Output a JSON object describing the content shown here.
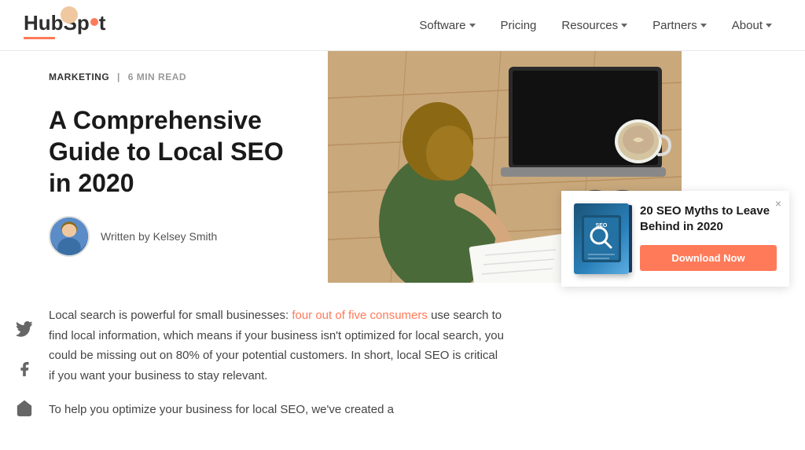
{
  "header": {
    "logo_text_hub": "Hub",
    "logo_text_spot": "Sp",
    "logo_text_spot2": "t",
    "nav_items": [
      {
        "label": "Software",
        "has_dropdown": true
      },
      {
        "label": "Pricing",
        "has_dropdown": false
      },
      {
        "label": "Resources",
        "has_dropdown": true
      },
      {
        "label": "Partners",
        "has_dropdown": true
      },
      {
        "label": "About",
        "has_dropdown": true
      }
    ]
  },
  "article": {
    "category": "MARKETING",
    "read_time": "6 MIN READ",
    "title": "A Comprehensive Guide to Local SEO in 2020",
    "author_label": "Written by Kelsey Smith",
    "body_paragraph1_start": "Local search is powerful for small businesses: ",
    "body_link": "four out of five consumers",
    "body_paragraph1_end": " use search to find local information, which means if your business isn't optimized for local search, you could be missing out on 80% of your potential customers. In short, local SEO is critical if you want your business to stay relevant.",
    "body_paragraph2": "To help you optimize your business for local SEO, we've created a"
  },
  "social": {
    "twitter_label": "twitter",
    "facebook_label": "facebook",
    "share_label": "share"
  },
  "ad": {
    "close_label": "×",
    "title": "20 SEO Myths to Leave Behind in 2020",
    "button_label": "Download Now"
  }
}
